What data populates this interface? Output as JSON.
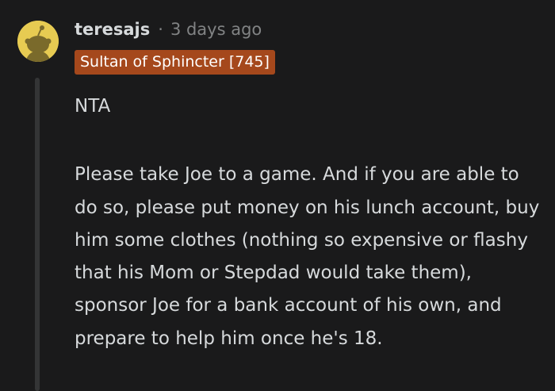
{
  "comment": {
    "username": "teresajs",
    "separator": "·",
    "timestamp": "3 days ago",
    "flair": "Sultan of Sphincter [745]",
    "paragraphs": [
      "NTA",
      "Please take Joe to a game. And if you are able to do so, please put money on his lunch account, buy him some clothes (nothing so expensive or flashy that his Mom or Stepdad would take them), sponsor Joe for a bank account of his own, and prepare to help him once he's 18."
    ],
    "avatar_icon": "snoo-avatar-icon"
  },
  "colors": {
    "background": "#1a1a1b",
    "text": "#d7dadc",
    "meta": "#818384",
    "flair_bg": "#a5481c",
    "avatar_bg": "#e7cb52",
    "thread_line": "#343536"
  }
}
